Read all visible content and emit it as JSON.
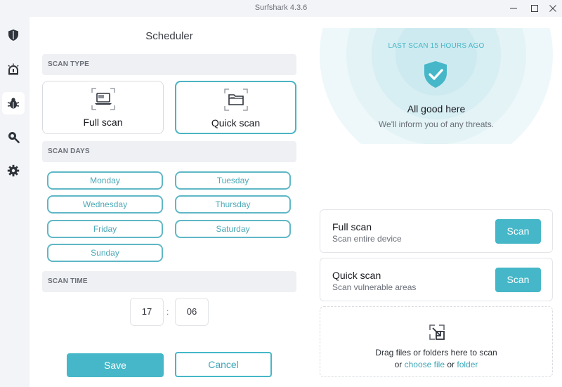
{
  "window": {
    "title": "Surfshark 4.3.6"
  },
  "sidebar": {
    "items": [
      {
        "icon": "shield-icon"
      },
      {
        "icon": "alert-icon"
      },
      {
        "icon": "bug-icon",
        "active": true
      },
      {
        "icon": "search-icon"
      },
      {
        "icon": "gear-icon"
      }
    ]
  },
  "scheduler": {
    "title": "Scheduler",
    "scan_type_header": "SCAN TYPE",
    "scan_types": [
      {
        "label": "Full scan",
        "icon": "laptop-icon",
        "selected": false
      },
      {
        "label": "Quick scan",
        "icon": "folder-icon",
        "selected": true
      }
    ],
    "scan_days_header": "SCAN DAYS",
    "days": [
      "Monday",
      "Tuesday",
      "Wednesday",
      "Thursday",
      "Friday",
      "Saturday",
      "Sunday"
    ],
    "scan_time_header": "SCAN TIME",
    "time": {
      "hour": "17",
      "separator": ":",
      "minute": "06"
    },
    "save_label": "Save",
    "cancel_label": "Cancel"
  },
  "status": {
    "last_scan": "LAST SCAN 15 HOURS AGO",
    "title": "All good here",
    "subtitle": "We'll inform you of any threats."
  },
  "scan_options": [
    {
      "title": "Full scan",
      "subtitle": "Scan entire device",
      "button": "Scan"
    },
    {
      "title": "Quick scan",
      "subtitle": "Scan vulnerable areas",
      "button": "Scan"
    }
  ],
  "drop_zone": {
    "line1": "Drag files or folders here to scan",
    "or1": "or",
    "choose_file": "choose file",
    "or2": "or",
    "folder": "folder"
  },
  "colors": {
    "accent": "#45b7c8",
    "sidebar_bg": "#f3f4f7",
    "header_bg": "#eff0f4"
  }
}
